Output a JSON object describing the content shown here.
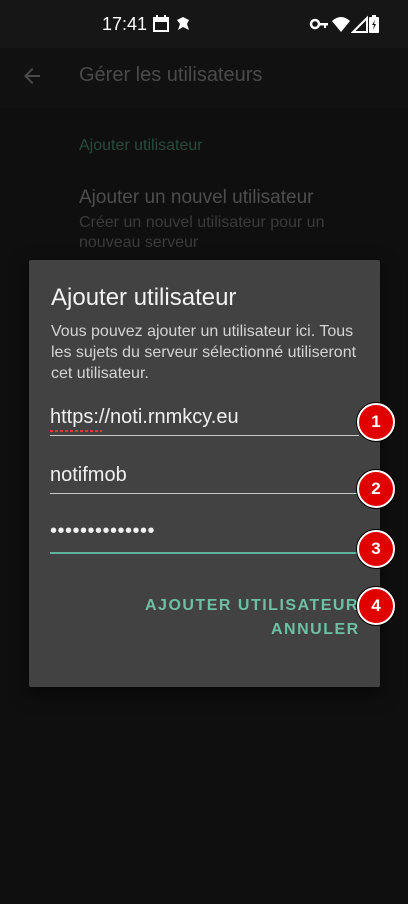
{
  "status_bar": {
    "time": "17:41",
    "icons": [
      "calendar-icon",
      "app-notification-icon",
      "key-icon",
      "wifi-icon",
      "signal-icon",
      "battery-icon"
    ]
  },
  "app_bar": {
    "back_icon": "arrow-left-icon",
    "title": "Gérer les utilisateurs"
  },
  "background": {
    "section_header": "Ajouter utilisateur",
    "item_title": "Ajouter un nouvel utilisateur",
    "item_description": "Créer un nouvel utilisateur pour un nouveau serveur"
  },
  "dialog": {
    "title": "Ajouter utilisateur",
    "message": "Vous pouvez ajouter un utilisateur ici. Tous les sujets du serveur sélectionné utiliseront cet utilisateur.",
    "fields": {
      "server_url": "https://noti.rnmkcy.eu",
      "username": "notifmob",
      "password": "••••••••••••••"
    },
    "buttons": {
      "add": "AJOUTER UTILISATEUR",
      "cancel": "ANNULER"
    }
  },
  "annotations": [
    "1",
    "2",
    "3",
    "4"
  ],
  "colors": {
    "accent": "#6fbfa5",
    "dialog_background": "#424242",
    "marker_red": "#e00000"
  }
}
